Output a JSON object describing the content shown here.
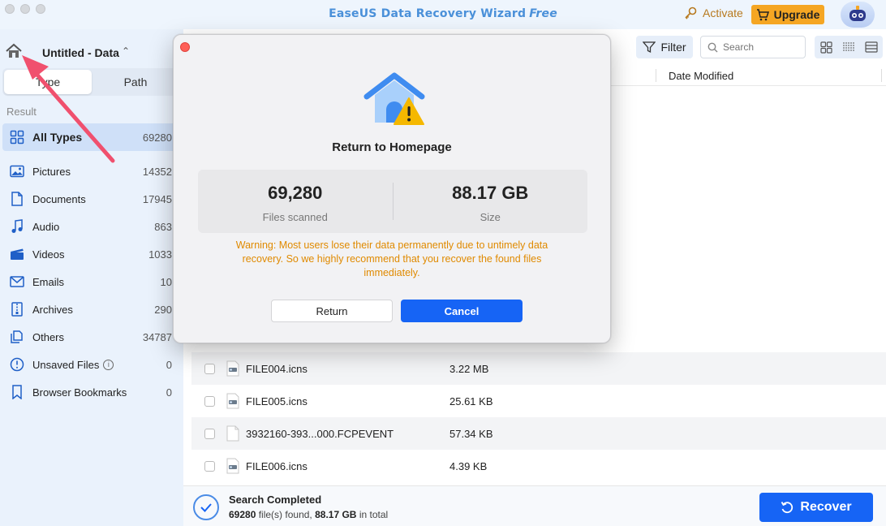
{
  "app": {
    "title": "EaseUS Data Recovery Wizard",
    "edition": "Free",
    "activate_label": "Activate",
    "upgrade_label": "Upgrade"
  },
  "sidebar": {
    "drive_name": "Untitled - Data",
    "tabs": [
      {
        "label": "Type",
        "active": true
      },
      {
        "label": "Path",
        "active": false
      }
    ],
    "section_label": "Result",
    "items": [
      {
        "label": "All Types",
        "count": "69280",
        "icon": "grid-icon"
      },
      {
        "label": "Pictures",
        "count": "14352",
        "icon": "image-icon"
      },
      {
        "label": "Documents",
        "count": "17945",
        "icon": "document-icon"
      },
      {
        "label": "Audio",
        "count": "863",
        "icon": "music-icon"
      },
      {
        "label": "Videos",
        "count": "1033",
        "icon": "clapperboard-icon"
      },
      {
        "label": "Emails",
        "count": "10",
        "icon": "mail-icon"
      },
      {
        "label": "Archives",
        "count": "290",
        "icon": "archive-icon"
      },
      {
        "label": "Others",
        "count": "34787",
        "icon": "others-icon"
      },
      {
        "label": "Unsaved Files",
        "count": "0",
        "icon": "info-icon"
      },
      {
        "label": "Browser Bookmarks",
        "count": "0",
        "icon": "bookmark-icon"
      }
    ]
  },
  "toolbar": {
    "filter_label": "Filter",
    "search_placeholder": "Search"
  },
  "table": {
    "date_column": "Date Modified",
    "rows": [
      {
        "name": "FILE004.icns",
        "size": "3.22 MB",
        "icon": "icns-file-icon"
      },
      {
        "name": "FILE005.icns",
        "size": "25.61 KB",
        "icon": "icns-file-icon"
      },
      {
        "name": "3932160-393...000.FCPEVENT",
        "size": "57.34 KB",
        "icon": "blank-file-icon"
      },
      {
        "name": "FILE006.icns",
        "size": "4.39 KB",
        "icon": "icns-file-icon"
      }
    ]
  },
  "status": {
    "title": "Search Completed",
    "count": "69280",
    "count_suffix": "file(s) found,",
    "size": "88.17 GB",
    "size_suffix": "in total",
    "recover_label": "Recover"
  },
  "modal": {
    "title": "Return to Homepage",
    "files_scanned_value": "69,280",
    "files_scanned_label": "Files scanned",
    "size_value": "88.17 GB",
    "size_label": "Size",
    "warning": "Warning: Most users lose their data permanently due to untimely data recovery. So we highly recommend that you recover the found files immediately.",
    "return_label": "Return",
    "cancel_label": "Cancel"
  },
  "colors": {
    "accent": "#1664f5",
    "warning": "#e08a00",
    "sidebar_bg": "#eaf2fc",
    "annotation": "#f0506e"
  }
}
